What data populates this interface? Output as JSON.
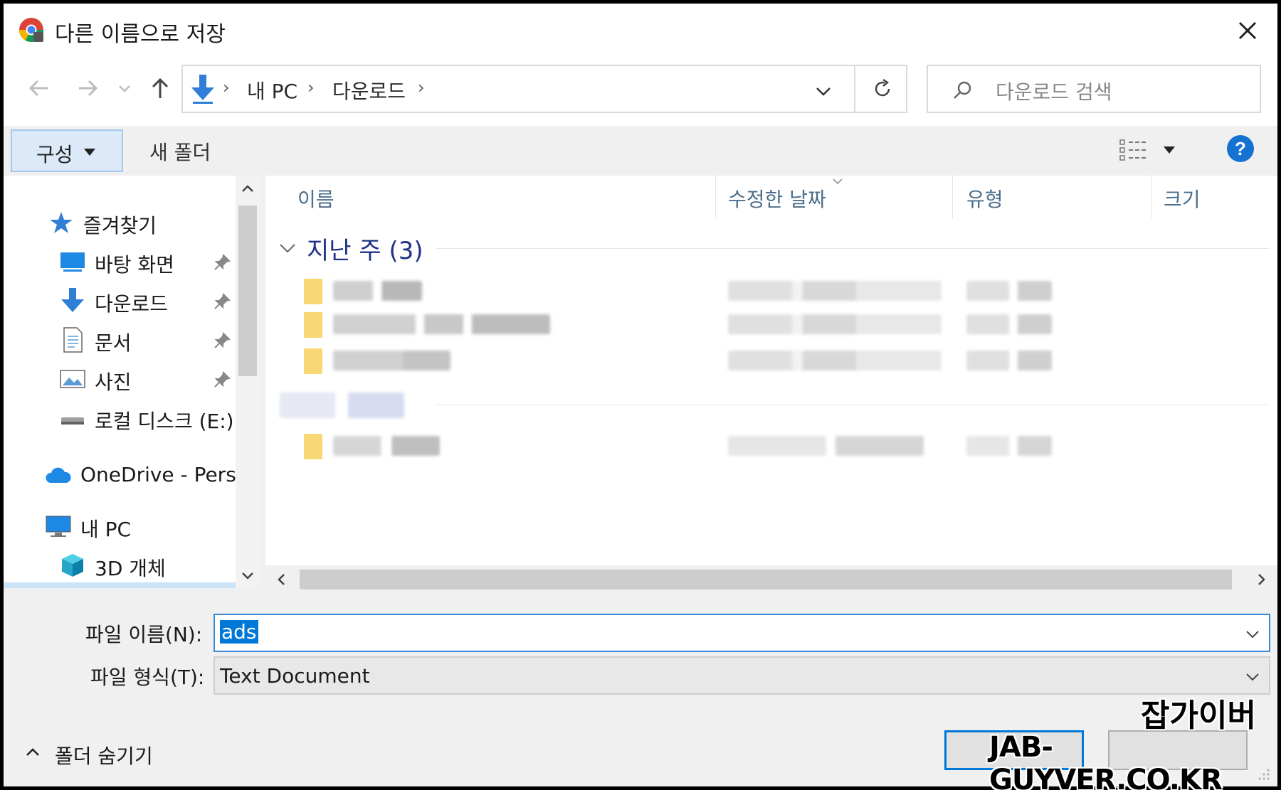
{
  "window": {
    "title": "다른 이름으로 저장"
  },
  "address": {
    "segments": [
      "내 PC",
      "다운로드"
    ]
  },
  "search": {
    "placeholder": "다운로드 검색"
  },
  "toolbar": {
    "organize_label": "구성",
    "new_folder_label": "새 폴더"
  },
  "sidebar": {
    "items": [
      {
        "label": "즐겨찾기"
      },
      {
        "label": "바탕 화면"
      },
      {
        "label": "다운로드"
      },
      {
        "label": "문서"
      },
      {
        "label": "사진"
      },
      {
        "label": "로컬 디스크 (E:)"
      },
      {
        "label": "OneDrive - Persoı"
      },
      {
        "label": "내 PC"
      },
      {
        "label": "3D 개체"
      }
    ]
  },
  "filelist": {
    "columns": [
      "이름",
      "수정한 날짜",
      "유형",
      "크기"
    ],
    "group_label": "지난 주 (3)"
  },
  "form": {
    "filename_label": "파일 이름(N):",
    "filename_value": "ads",
    "filetype_label": "파일 형식(T):",
    "filetype_value": "Text Document"
  },
  "footer": {
    "hide_folders_label": "폴더 숨기기"
  },
  "watermark": {
    "line1": "잡가이버",
    "line2": "JAB-GUYVER.CO.KR"
  },
  "colors": {
    "accent": "#0078d7",
    "group_header": "#1e3287",
    "folder": "#f8d775"
  }
}
